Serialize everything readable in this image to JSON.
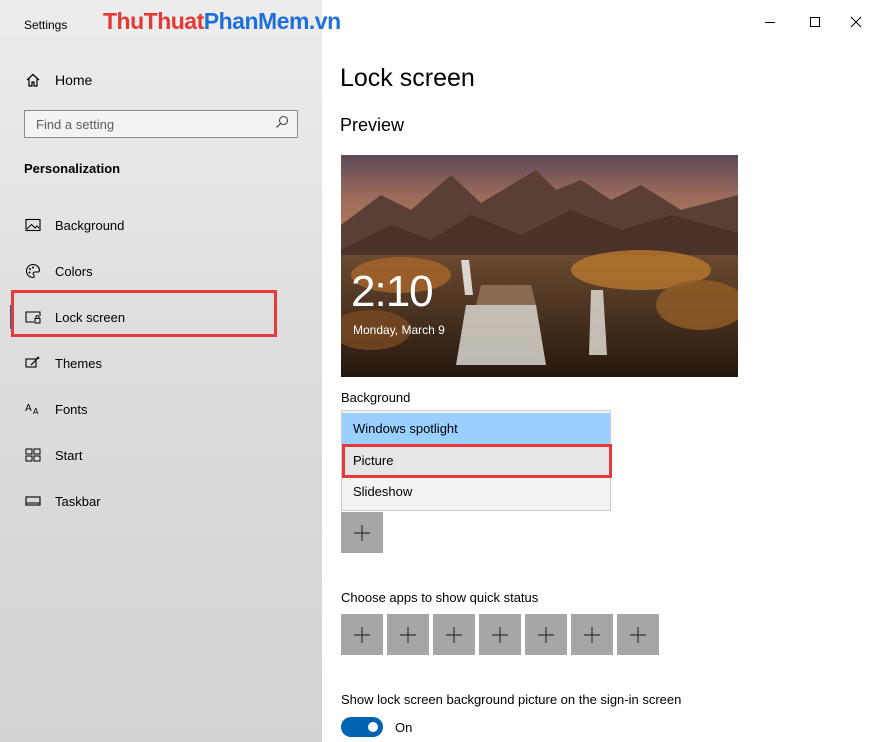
{
  "window": {
    "app_title": "Settings",
    "watermark": {
      "part1": "Thu",
      "part2": "Thuat",
      "part3": "PhanMem",
      "part4": ".vn"
    },
    "controls": [
      "minimize-icon",
      "maximize-icon",
      "close-icon"
    ]
  },
  "sidebar": {
    "home_label": "Home",
    "search_placeholder": "Find a setting",
    "section": "Personalization",
    "selected": "Lock screen",
    "items": [
      {
        "label": "Background",
        "icon": "picture-icon"
      },
      {
        "label": "Colors",
        "icon": "palette-icon"
      },
      {
        "label": "Lock screen",
        "icon": "lock-screen-icon"
      },
      {
        "label": "Themes",
        "icon": "themes-icon"
      },
      {
        "label": "Fonts",
        "icon": "fonts-icon"
      },
      {
        "label": "Start",
        "icon": "start-icon"
      },
      {
        "label": "Taskbar",
        "icon": "taskbar-icon"
      }
    ]
  },
  "main": {
    "title": "Lock screen",
    "preview_title": "Preview",
    "preview": {
      "time": "2:10",
      "date": "Monday, March 9"
    },
    "background_label": "Background",
    "background_options": [
      "Windows spotlight",
      "Picture",
      "Slideshow"
    ],
    "background_highlighted": "Windows spotlight",
    "quick_status_label": "Choose apps to show quick status",
    "quick_status_slots": 7,
    "signin_label": "Show lock screen background picture on the sign-in screen",
    "signin_toggle": {
      "state": "On",
      "on": true
    }
  },
  "colors": {
    "accent": "#0063b1",
    "highlight": "#99d0ff",
    "annotation_red": "#e5393c",
    "add_button": "#a6a6a6"
  }
}
